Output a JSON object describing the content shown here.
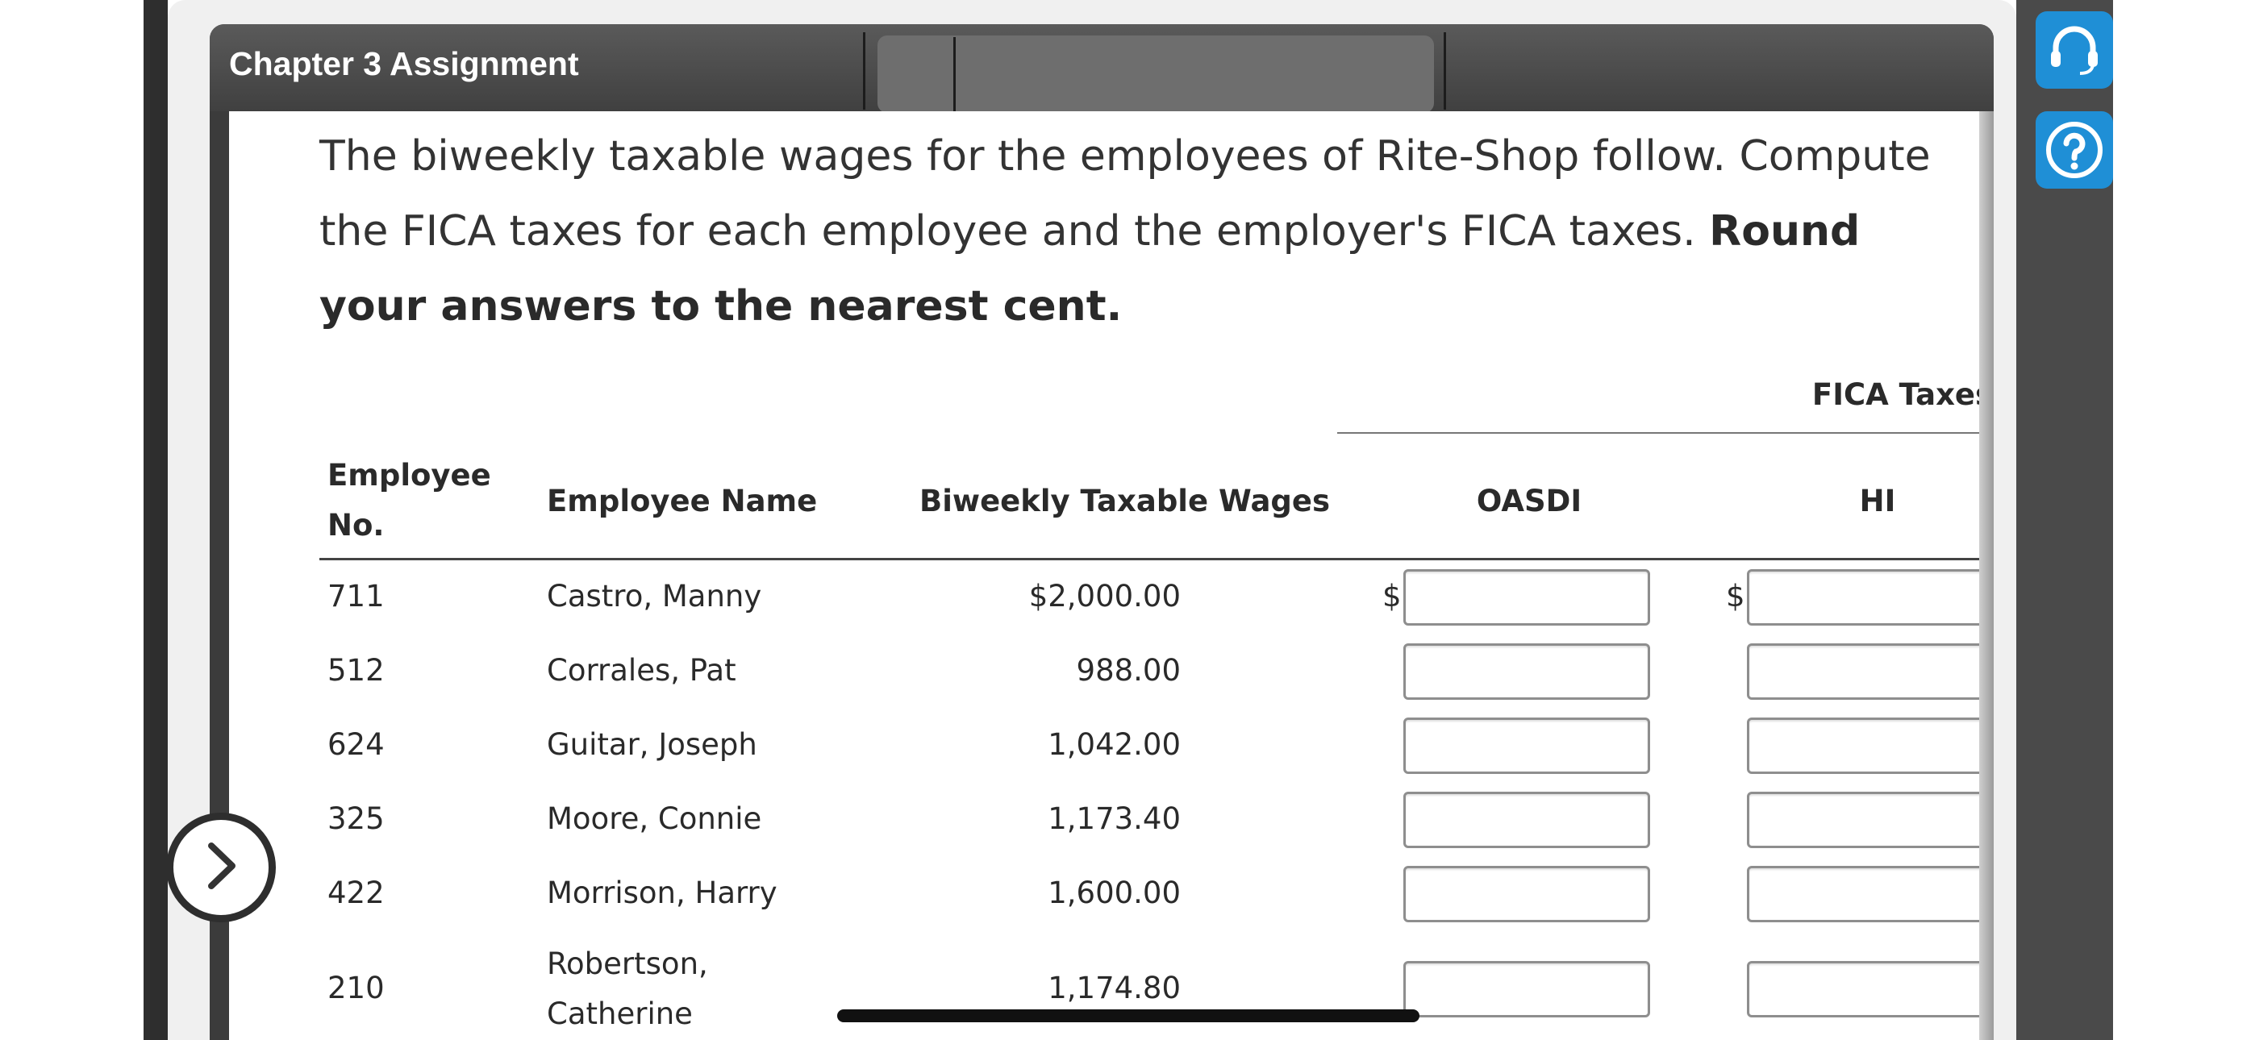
{
  "header": {
    "title": "Chapter 3 Assignment"
  },
  "question": {
    "text": "The biweekly taxable wages for the employees of Rite-Shop follow. Compute the FICA taxes for each employee and the employer's FICA taxes.",
    "emphasis": "Round your answers to the nearest cent."
  },
  "table": {
    "group_header": "FICA Taxes",
    "columns": {
      "employee_no_line1": "Employee",
      "employee_no_line2": "No.",
      "employee_name": "Employee Name",
      "wages": "Biweekly Taxable Wages",
      "oasdi": "OASDI",
      "hi": "HI"
    },
    "currency_symbol": "$",
    "rows": [
      {
        "no": "711",
        "name": "Castro, Manny",
        "wages": "$2,000.00",
        "oasdi": "",
        "hi": ""
      },
      {
        "no": "512",
        "name": "Corrales, Pat",
        "wages": "988.00",
        "oasdi": "",
        "hi": ""
      },
      {
        "no": "624",
        "name": "Guitar, Joseph",
        "wages": "1,042.00",
        "oasdi": "",
        "hi": ""
      },
      {
        "no": "325",
        "name": "Moore, Connie",
        "wages": "1,173.40",
        "oasdi": "",
        "hi": ""
      },
      {
        "no": "422",
        "name": "Morrison, Harry",
        "wages": "1,600.00",
        "oasdi": "",
        "hi": ""
      },
      {
        "no": "210",
        "name_line1": "Robertson,",
        "name_line2": "Catherine",
        "wages": "1,174.80",
        "oasdi": "",
        "hi": ""
      }
    ]
  },
  "side_icons": {
    "support": "headset-icon",
    "help": "help-question-icon"
  },
  "navigation": {
    "next": "chevron-right-icon"
  },
  "colors": {
    "side_button": "#1f8fd6",
    "header_bar": "#4a4a4a",
    "text": "#333333"
  }
}
